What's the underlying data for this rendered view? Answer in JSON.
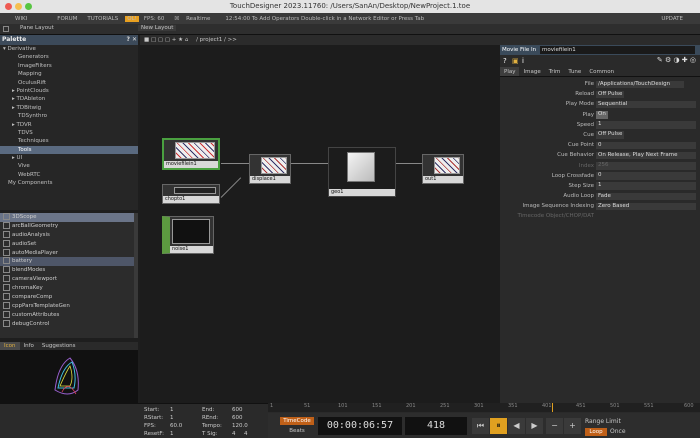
{
  "window": {
    "title": "TouchDesigner 2023.11760: /Users/SanAn/Desktop/NewProject.1.toe"
  },
  "menu": {
    "items": [
      "WIKI",
      "FORUM",
      "TUTORIALS"
    ],
    "ol_badge": "OL!",
    "fps_label": "FPS: 60",
    "realtime": "Realtime",
    "status": "12:54:00 To Add Operators Double-click in a Network Editor or Press Tab",
    "update": "UPDATE"
  },
  "panebar": {
    "pane_layout": "Pane Layout",
    "new_layout": "New Layout"
  },
  "palette": {
    "title": "Palette",
    "tree": [
      "Derivative",
      "Generators",
      "ImageFilters",
      "Mapping",
      "OculusRift",
      "PointClouds",
      "TDAbleton",
      "TDBitwig",
      "TDSynthro",
      "TDVR",
      "TDVS",
      "Techniques",
      "Tools",
      "UI",
      "Vive",
      "WebRTC",
      "My Components"
    ],
    "list": [
      "3DScope",
      "arcBallGeometry",
      "audioAnalysis",
      "audioSet",
      "autoMediaPlayer",
      "battery",
      "blendModes",
      "cameraViewport",
      "chromaKey",
      "compareComp",
      "cppParsTemplateGen",
      "customAttributes",
      "debugControl"
    ],
    "tabs": [
      "Icon",
      "Info",
      "Suggestions"
    ]
  },
  "network": {
    "path": "/ project1 / >>",
    "nodes": {
      "moviefilein1": "moviefilein1",
      "chopto1": "chopto1",
      "noise1": "noise1",
      "displace1": "displace1",
      "geo1": "geo1",
      "out1": "out1"
    }
  },
  "params": {
    "op_type": "Movie File In",
    "op_name": "moviefilein1",
    "tabs": [
      "Play",
      "Image",
      "Trim",
      "Tune",
      "Common"
    ],
    "rows": [
      {
        "label": "File",
        "value": "/Applications/TouchDesign"
      },
      {
        "label": "Reload",
        "value": "Off   Pulse"
      },
      {
        "label": "Play Mode",
        "value": "Sequential"
      },
      {
        "label": "Play",
        "value": "On"
      },
      {
        "label": "Speed",
        "value": "1"
      },
      {
        "label": "Cue",
        "value": "Off   Pulse"
      },
      {
        "label": "Cue Point",
        "value": "0"
      },
      {
        "label": "Cue Behavior",
        "value": "On Release, Play Next Frame"
      },
      {
        "label": "Index",
        "value": "256"
      },
      {
        "label": "Loop Crossfade",
        "value": "0"
      },
      {
        "label": "Step Size",
        "value": "1"
      },
      {
        "label": "Audio Loop",
        "value": "Fade"
      },
      {
        "label": "Image Sequence Indexing",
        "value": "Zero Based"
      },
      {
        "label": "Timecode Object/CHOP/DAT",
        "value": ""
      }
    ]
  },
  "timeline": {
    "start": "1",
    "end": "600",
    "rstart": "1",
    "rend": "600",
    "fps": "60.0",
    "tempo": "120.0",
    "resetf": "1",
    "tsig_a": "4",
    "tsig_b": "4",
    "ticks": [
      "1",
      "51",
      "101",
      "151",
      "201",
      "251",
      "301",
      "351",
      "401",
      "451",
      "501",
      "551",
      "600"
    ],
    "timecode_tab": "TimeCode",
    "beats_tab": "Beats",
    "timecode": "00:00:06:57",
    "frame": "418",
    "range_limit": "Range Limit",
    "loop": "Loop",
    "once": "Once"
  }
}
